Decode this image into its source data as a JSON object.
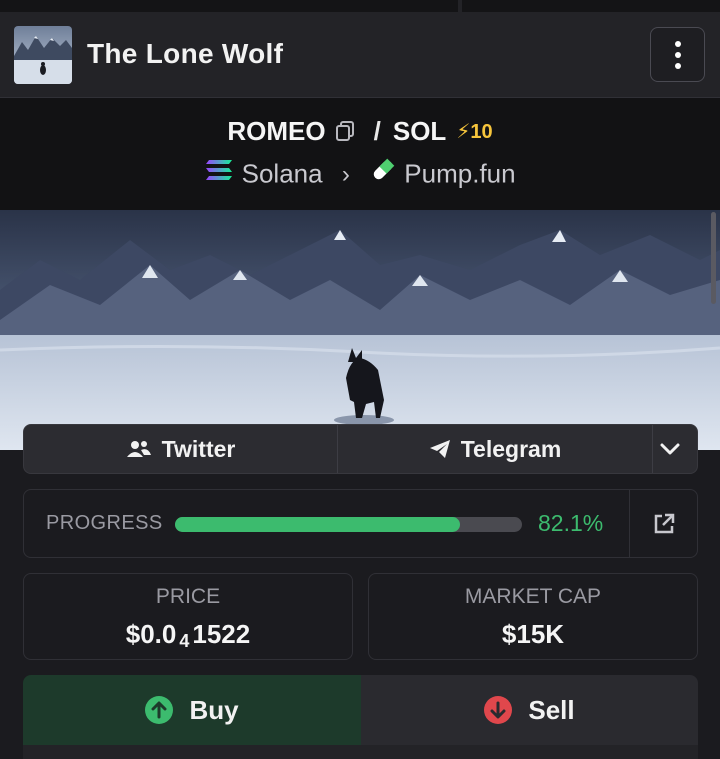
{
  "header": {
    "title": "The Lone Wolf",
    "menu_icon": "more-vertical-icon"
  },
  "pair": {
    "base": "ROMEO",
    "separator": "/",
    "quote": "SOL",
    "boost": "10",
    "chain": "Solana",
    "chevron": "›",
    "dex": "Pump.fun"
  },
  "social": {
    "twitter": "Twitter",
    "telegram": "Telegram"
  },
  "progress": {
    "label": "PROGRESS",
    "value": 0.821,
    "text": "82.1%"
  },
  "stats": {
    "price_label": "PRICE",
    "price_prefix": "$0.0",
    "price_zeros": "4",
    "price_digits": "1522",
    "mcap_label": "MARKET CAP",
    "mcap_value": "$15K"
  },
  "trade": {
    "buy": "Buy",
    "sell": "Sell"
  },
  "colors": {
    "accent_green": "#3cbb6e",
    "sell_red": "#e0474c",
    "boost_yellow": "#f7c53c"
  }
}
